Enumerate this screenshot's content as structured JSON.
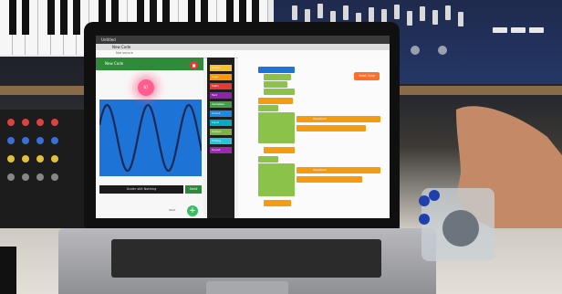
{
  "browser": {
    "title": "Untitled",
    "tab_title": "New Code",
    "url": "Not secure"
  },
  "app": {
    "header_title": "New Code",
    "stop_label": "■",
    "slider_value": "67",
    "bottom_label": "Under still Nothing",
    "send_label": "Send",
    "fab_label": "Start",
    "fab_symbol": "+"
  },
  "palette": {
    "categories": [
      "Loops",
      "Logic",
      "Math",
      "Text",
      "Variables",
      "Colour",
      "Input",
      "Output",
      "Timing",
      "Sound"
    ]
  },
  "workspace": {
    "start_label": "Start Stop",
    "blocks": [
      "Waveform",
      "Waveform"
    ]
  },
  "colors": {
    "app_green": "#2f8a3a",
    "plot_blue": "#1e73d6",
    "block_orange": "#f39c12",
    "block_green": "#8bc34a"
  }
}
